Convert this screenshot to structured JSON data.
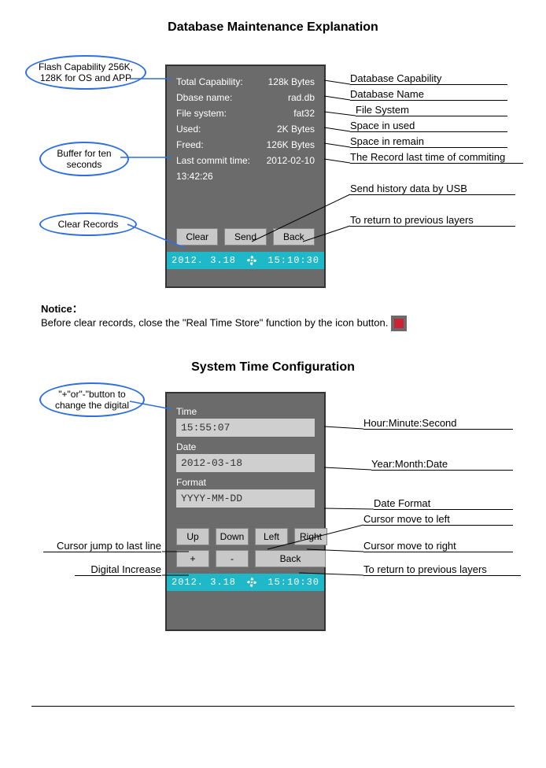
{
  "section1": {
    "title": "Database Maintenance Explanation",
    "callouts": {
      "flash": "Flash Capability 256K, 128K  for OS and APP",
      "buffer": "Buffer for ten seconds",
      "clear": "Clear Records"
    },
    "device": {
      "rows": [
        {
          "label": "Total Capability:",
          "value": "128k Bytes"
        },
        {
          "label": "Dbase name:",
          "value": "rad.db"
        },
        {
          "label": "File system:",
          "value": "fat32"
        },
        {
          "label": "Used:",
          "value": "2K Bytes"
        },
        {
          "label": "Freed:",
          "value": "126K Bytes"
        },
        {
          "label": "Last commit time:",
          "value": "2012-02-10"
        }
      ],
      "extra": "13:42:26",
      "buttons": {
        "clear": "Clear",
        "send": "Send",
        "back": "Back"
      },
      "status": {
        "date": "2012. 3.18",
        "time": "15:10:30"
      }
    },
    "annots": {
      "cap": "Database Capability",
      "name": "Database Name",
      "fs": "File System",
      "used": "Space in used",
      "freed": "Space in remain",
      "commit": "The Record last time of commiting",
      "send": "Send history data by USB",
      "back": "To return to previous layers"
    },
    "notice_label": "Notice：",
    "notice_text": "Before clear records, close the \"Real Time Store\" function  by the icon button."
  },
  "section2": {
    "title": "System Time Configuration",
    "callouts": {
      "plusminus": "\"+\"or\"-\"button to change the digital"
    },
    "device": {
      "time_label": "Time",
      "time_value": "15:55:07",
      "date_label": "Date",
      "date_value": "2012-03-18",
      "format_label": "Format",
      "format_value": "YYYY-MM-DD",
      "buttons": {
        "up": "Up",
        "down": "Down",
        "left": "Left",
        "right": "Right",
        "plus": "+",
        "minus": "-",
        "back": "Back"
      },
      "status": {
        "date": "2012. 3.18",
        "time": "15:10:30"
      }
    },
    "annots": {
      "time": "Hour:Minute:Second",
      "date": "Year:Month:Date",
      "format": "Date Format",
      "left": "Cursor move to left",
      "right": "Cursor move to right",
      "up": "Cursor jump to last line",
      "plus": "Digital Increase",
      "back": "To return to previous layers"
    }
  }
}
